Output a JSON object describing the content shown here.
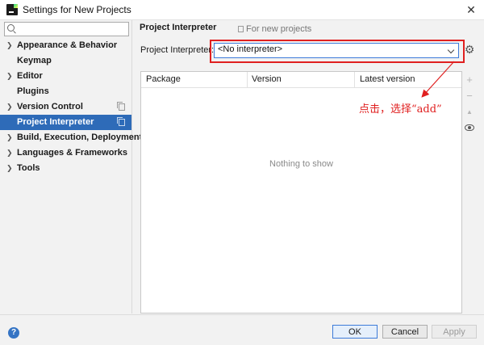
{
  "window": {
    "title": "Settings for New Projects",
    "close_glyph": "✕"
  },
  "search": {
    "value": "",
    "placeholder": ""
  },
  "sidebar": {
    "items": [
      {
        "label": "Appearance & Behavior",
        "expandable": true,
        "selected": false,
        "has_copy_icon": false
      },
      {
        "label": "Keymap",
        "expandable": false,
        "selected": false,
        "has_copy_icon": false
      },
      {
        "label": "Editor",
        "expandable": true,
        "selected": false,
        "has_copy_icon": false
      },
      {
        "label": "Plugins",
        "expandable": false,
        "selected": false,
        "has_copy_icon": false
      },
      {
        "label": "Version Control",
        "expandable": true,
        "selected": false,
        "has_copy_icon": true
      },
      {
        "label": "Project Interpreter",
        "expandable": false,
        "selected": true,
        "has_copy_icon": true
      },
      {
        "label": "Build, Execution, Deployment",
        "expandable": true,
        "selected": false,
        "has_copy_icon": false
      },
      {
        "label": "Languages & Frameworks",
        "expandable": true,
        "selected": false,
        "has_copy_icon": false
      },
      {
        "label": "Tools",
        "expandable": true,
        "selected": false,
        "has_copy_icon": false
      }
    ],
    "arrow_glyph": "❯"
  },
  "main": {
    "section_title": "Project Interpreter",
    "scope_label": "For new projects",
    "interpreter_label": "Project Interpreter:",
    "interpreter_value": "<No interpreter>",
    "gear_glyph": "⚙",
    "table": {
      "columns": [
        "Package",
        "Version",
        "Latest version"
      ],
      "empty_text": "Nothing to show"
    },
    "tools": {
      "add_glyph": "+",
      "remove_glyph": "−",
      "up_glyph": "▲"
    }
  },
  "annotation": {
    "text": "点击，选择“add”",
    "color": "#e02020"
  },
  "footer": {
    "help_glyph": "?",
    "ok_label": "OK",
    "cancel_label": "Cancel",
    "apply_label": "Apply"
  },
  "colors": {
    "selection": "#2e6bb8",
    "focus_border": "#3d7bd9",
    "annotation": "#e02020"
  }
}
